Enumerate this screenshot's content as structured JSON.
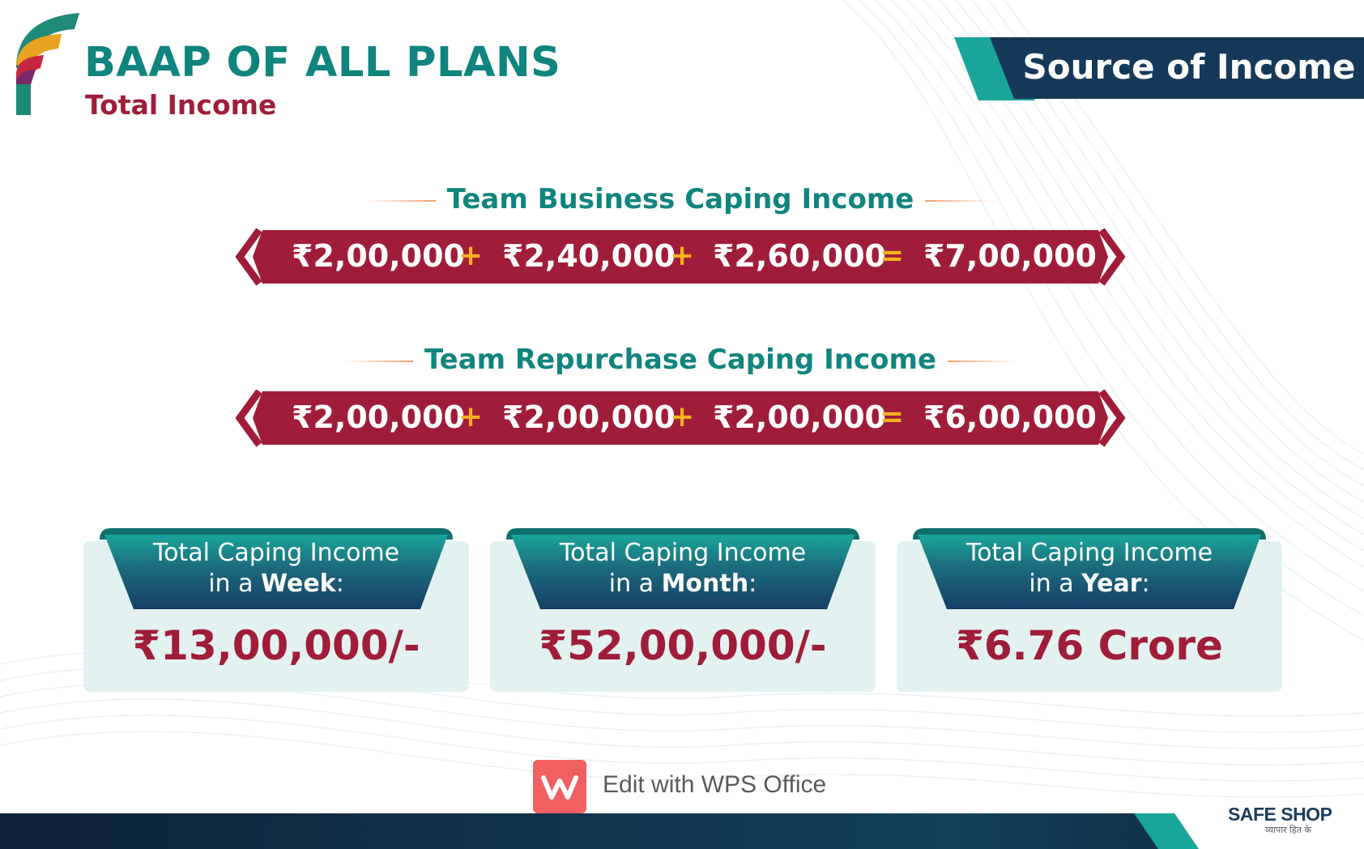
{
  "header": {
    "title": "BAAP OF ALL PLANS",
    "subtitle": "Total Income",
    "source_banner": "Source of Income"
  },
  "sections": [
    {
      "heading": "Team Business Caping Income",
      "terms": [
        "₹2,00,000",
        "₹2,40,000",
        "₹2,60,000"
      ],
      "operators": [
        "+",
        "+",
        "="
      ],
      "result": "₹7,00,000"
    },
    {
      "heading": "Team Repurchase Caping Income",
      "terms": [
        "₹2,00,000",
        "₹2,00,000",
        "₹2,00,000"
      ],
      "operators": [
        "+",
        "+",
        "="
      ],
      "result": "₹6,00,000"
    }
  ],
  "cards": [
    {
      "label_line1": "Total Caping Income",
      "label_prefix": "in a ",
      "label_period": "Week",
      "label_suffix": ":",
      "value": "₹13,00,000/-"
    },
    {
      "label_line1": "Total Caping Income",
      "label_prefix": "in a ",
      "label_period": "Month",
      "label_suffix": ":",
      "value": "₹52,00,000/-"
    },
    {
      "label_line1": "Total Caping Income",
      "label_prefix": "in a ",
      "label_period": "Year",
      "label_suffix": ":",
      "value": "₹6.76 Crore"
    }
  ],
  "watermark": {
    "label": "Edit with WPS Office",
    "icon": "wps-office-icon"
  },
  "brand": {
    "name": "SAFE SHOP",
    "tagline": "व्यापार हित के"
  },
  "colors": {
    "teal": "#10847e",
    "maroon": "#a01d3a",
    "navy": "#16395a",
    "gold": "#f5b21f",
    "card_bg": "#e3f2f1"
  }
}
